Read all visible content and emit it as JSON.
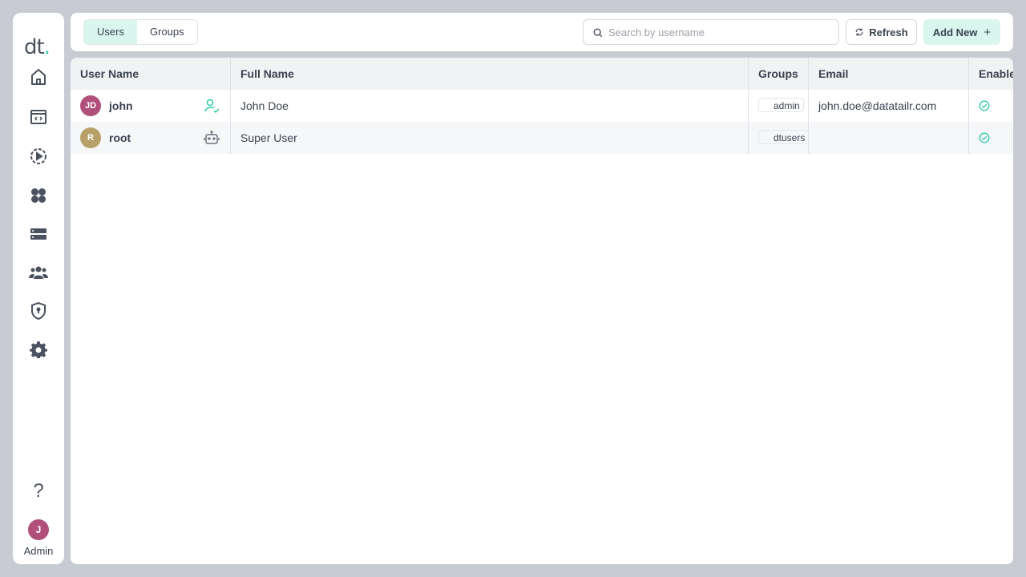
{
  "sidebar": {
    "logo_text": "dt",
    "logo_dot": ".",
    "nav": [
      {
        "name": "home-icon"
      },
      {
        "name": "code-window-icon"
      },
      {
        "name": "play-circle-icon"
      },
      {
        "name": "apps-grid-icon"
      },
      {
        "name": "server-icon"
      },
      {
        "name": "users-icon"
      },
      {
        "name": "shield-icon"
      },
      {
        "name": "gear-icon"
      }
    ],
    "help": "?",
    "avatar_initial": "J",
    "user_label": "Admin"
  },
  "toolbar": {
    "tabs": [
      {
        "label": "Users",
        "active": true
      },
      {
        "label": "Groups",
        "active": false
      }
    ],
    "search_placeholder": "Search by username",
    "refresh_label": "Refresh",
    "add_label": "Add New",
    "add_icon": "+"
  },
  "table": {
    "columns": [
      "User Name",
      "Full Name",
      "Groups",
      "Email",
      "Enabled"
    ],
    "rows": [
      {
        "initials": "JD",
        "avatar_color": "#b04f7a",
        "username": "john",
        "type_icon": "user-check-icon",
        "full_name": "John Doe",
        "group": "admin",
        "email": "john.doe@datatailr.com",
        "enabled": true
      },
      {
        "initials": "R",
        "avatar_color": "#b8a06a",
        "username": "root",
        "type_icon": "robot-icon",
        "full_name": "Super User",
        "group": "dtusers",
        "email": "",
        "enabled": true
      }
    ]
  },
  "colors": {
    "accent": "#2bc8a8",
    "accent_bg": "#d8f5ee",
    "text": "#3b4350"
  }
}
